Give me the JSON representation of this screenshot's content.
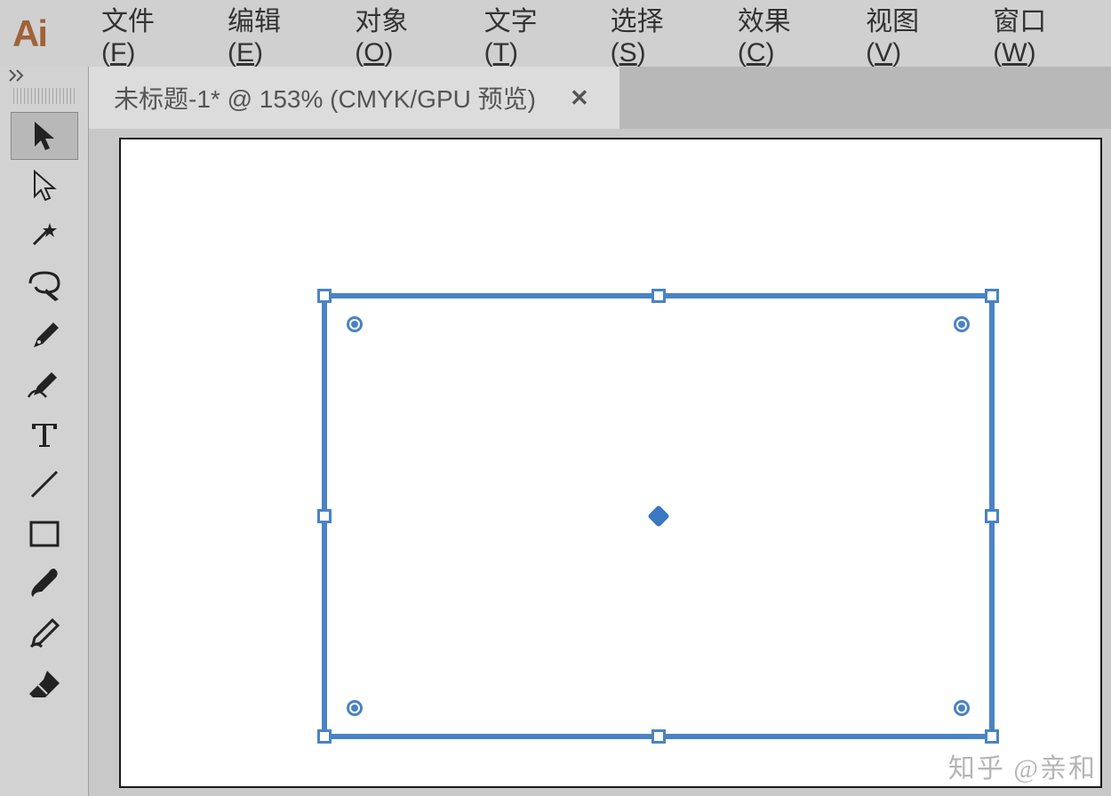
{
  "app": {
    "logo": "Ai"
  },
  "menu": {
    "items": [
      {
        "label": "文件",
        "key": "F"
      },
      {
        "label": "编辑",
        "key": "E"
      },
      {
        "label": "对象",
        "key": "O"
      },
      {
        "label": "文字",
        "key": "T"
      },
      {
        "label": "选择",
        "key": "S"
      },
      {
        "label": "效果",
        "key": "C"
      },
      {
        "label": "视图",
        "key": "V"
      },
      {
        "label": "窗口",
        "key": "W"
      }
    ]
  },
  "tabs": {
    "active": {
      "title": "未标题-1* @ 153% (CMYK/GPU 预览)",
      "close": "✕"
    }
  },
  "document": {
    "name": "未标题-1",
    "modified": true,
    "zoom_percent": 153,
    "color_mode": "CMYK",
    "preview_mode": "GPU 预览"
  },
  "tools": [
    {
      "name": "selection-tool",
      "selected": true
    },
    {
      "name": "direct-selection-tool",
      "selected": false
    },
    {
      "name": "magic-wand-tool",
      "selected": false
    },
    {
      "name": "lasso-tool",
      "selected": false
    },
    {
      "name": "pen-tool",
      "selected": false
    },
    {
      "name": "curvature-tool",
      "selected": false
    },
    {
      "name": "type-tool",
      "selected": false
    },
    {
      "name": "line-segment-tool",
      "selected": false
    },
    {
      "name": "rectangle-tool",
      "selected": false
    },
    {
      "name": "paintbrush-tool",
      "selected": false
    },
    {
      "name": "shaper-tool",
      "selected": false
    },
    {
      "name": "eraser-tool",
      "selected": false
    }
  ],
  "colors": {
    "selection": "#4a83c4"
  },
  "watermark": "知乎 @亲和"
}
